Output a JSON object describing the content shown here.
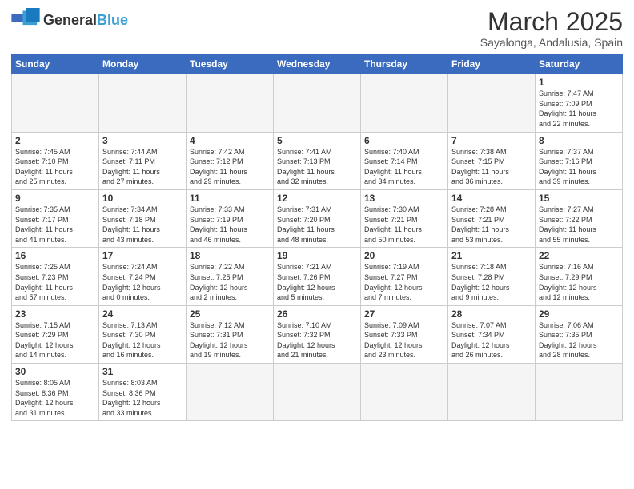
{
  "header": {
    "logo_general": "General",
    "logo_blue": "Blue",
    "month_title": "March 2025",
    "location": "Sayalonga, Andalusia, Spain"
  },
  "weekdays": [
    "Sunday",
    "Monday",
    "Tuesday",
    "Wednesday",
    "Thursday",
    "Friday",
    "Saturday"
  ],
  "weeks": [
    [
      {
        "day": "",
        "info": ""
      },
      {
        "day": "",
        "info": ""
      },
      {
        "day": "",
        "info": ""
      },
      {
        "day": "",
        "info": ""
      },
      {
        "day": "",
        "info": ""
      },
      {
        "day": "",
        "info": ""
      },
      {
        "day": "1",
        "info": "Sunrise: 7:47 AM\nSunset: 7:09 PM\nDaylight: 11 hours\nand 22 minutes."
      }
    ],
    [
      {
        "day": "2",
        "info": "Sunrise: 7:45 AM\nSunset: 7:10 PM\nDaylight: 11 hours\nand 25 minutes."
      },
      {
        "day": "3",
        "info": "Sunrise: 7:44 AM\nSunset: 7:11 PM\nDaylight: 11 hours\nand 27 minutes."
      },
      {
        "day": "4",
        "info": "Sunrise: 7:42 AM\nSunset: 7:12 PM\nDaylight: 11 hours\nand 29 minutes."
      },
      {
        "day": "5",
        "info": "Sunrise: 7:41 AM\nSunset: 7:13 PM\nDaylight: 11 hours\nand 32 minutes."
      },
      {
        "day": "6",
        "info": "Sunrise: 7:40 AM\nSunset: 7:14 PM\nDaylight: 11 hours\nand 34 minutes."
      },
      {
        "day": "7",
        "info": "Sunrise: 7:38 AM\nSunset: 7:15 PM\nDaylight: 11 hours\nand 36 minutes."
      },
      {
        "day": "8",
        "info": "Sunrise: 7:37 AM\nSunset: 7:16 PM\nDaylight: 11 hours\nand 39 minutes."
      }
    ],
    [
      {
        "day": "9",
        "info": "Sunrise: 7:35 AM\nSunset: 7:17 PM\nDaylight: 11 hours\nand 41 minutes."
      },
      {
        "day": "10",
        "info": "Sunrise: 7:34 AM\nSunset: 7:18 PM\nDaylight: 11 hours\nand 43 minutes."
      },
      {
        "day": "11",
        "info": "Sunrise: 7:33 AM\nSunset: 7:19 PM\nDaylight: 11 hours\nand 46 minutes."
      },
      {
        "day": "12",
        "info": "Sunrise: 7:31 AM\nSunset: 7:20 PM\nDaylight: 11 hours\nand 48 minutes."
      },
      {
        "day": "13",
        "info": "Sunrise: 7:30 AM\nSunset: 7:21 PM\nDaylight: 11 hours\nand 50 minutes."
      },
      {
        "day": "14",
        "info": "Sunrise: 7:28 AM\nSunset: 7:21 PM\nDaylight: 11 hours\nand 53 minutes."
      },
      {
        "day": "15",
        "info": "Sunrise: 7:27 AM\nSunset: 7:22 PM\nDaylight: 11 hours\nand 55 minutes."
      }
    ],
    [
      {
        "day": "16",
        "info": "Sunrise: 7:25 AM\nSunset: 7:23 PM\nDaylight: 11 hours\nand 57 minutes."
      },
      {
        "day": "17",
        "info": "Sunrise: 7:24 AM\nSunset: 7:24 PM\nDaylight: 12 hours\nand 0 minutes."
      },
      {
        "day": "18",
        "info": "Sunrise: 7:22 AM\nSunset: 7:25 PM\nDaylight: 12 hours\nand 2 minutes."
      },
      {
        "day": "19",
        "info": "Sunrise: 7:21 AM\nSunset: 7:26 PM\nDaylight: 12 hours\nand 5 minutes."
      },
      {
        "day": "20",
        "info": "Sunrise: 7:19 AM\nSunset: 7:27 PM\nDaylight: 12 hours\nand 7 minutes."
      },
      {
        "day": "21",
        "info": "Sunrise: 7:18 AM\nSunset: 7:28 PM\nDaylight: 12 hours\nand 9 minutes."
      },
      {
        "day": "22",
        "info": "Sunrise: 7:16 AM\nSunset: 7:29 PM\nDaylight: 12 hours\nand 12 minutes."
      }
    ],
    [
      {
        "day": "23",
        "info": "Sunrise: 7:15 AM\nSunset: 7:29 PM\nDaylight: 12 hours\nand 14 minutes."
      },
      {
        "day": "24",
        "info": "Sunrise: 7:13 AM\nSunset: 7:30 PM\nDaylight: 12 hours\nand 16 minutes."
      },
      {
        "day": "25",
        "info": "Sunrise: 7:12 AM\nSunset: 7:31 PM\nDaylight: 12 hours\nand 19 minutes."
      },
      {
        "day": "26",
        "info": "Sunrise: 7:10 AM\nSunset: 7:32 PM\nDaylight: 12 hours\nand 21 minutes."
      },
      {
        "day": "27",
        "info": "Sunrise: 7:09 AM\nSunset: 7:33 PM\nDaylight: 12 hours\nand 23 minutes."
      },
      {
        "day": "28",
        "info": "Sunrise: 7:07 AM\nSunset: 7:34 PM\nDaylight: 12 hours\nand 26 minutes."
      },
      {
        "day": "29",
        "info": "Sunrise: 7:06 AM\nSunset: 7:35 PM\nDaylight: 12 hours\nand 28 minutes."
      }
    ],
    [
      {
        "day": "30",
        "info": "Sunrise: 8:05 AM\nSunset: 8:36 PM\nDaylight: 12 hours\nand 31 minutes."
      },
      {
        "day": "31",
        "info": "Sunrise: 8:03 AM\nSunset: 8:36 PM\nDaylight: 12 hours\nand 33 minutes."
      },
      {
        "day": "",
        "info": ""
      },
      {
        "day": "",
        "info": ""
      },
      {
        "day": "",
        "info": ""
      },
      {
        "day": "",
        "info": ""
      },
      {
        "day": "",
        "info": ""
      }
    ]
  ]
}
